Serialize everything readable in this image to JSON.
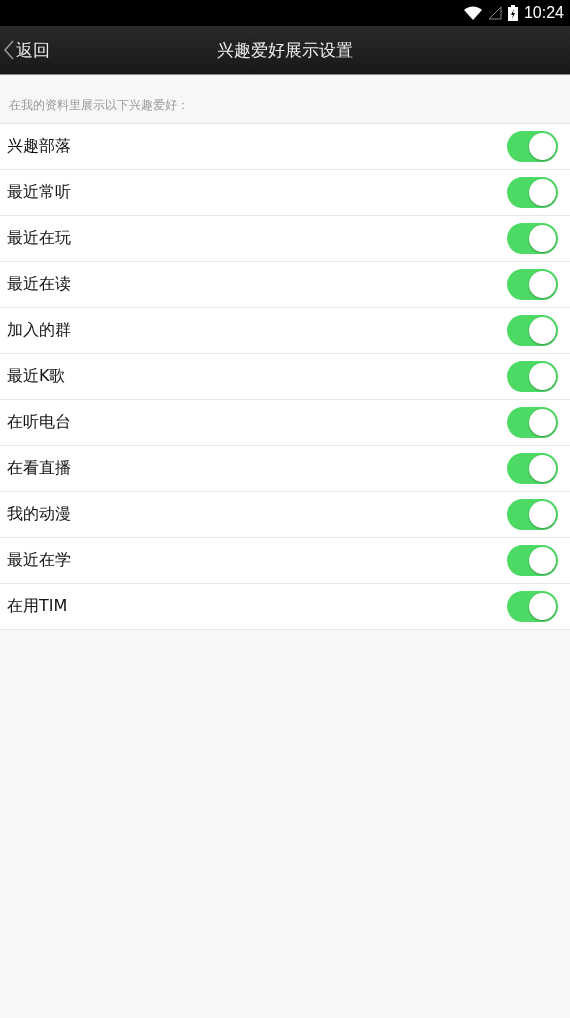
{
  "status_bar": {
    "time": "10:24"
  },
  "nav": {
    "back": "返回",
    "title": "兴趣爱好展示设置"
  },
  "section_hint": "在我的资料里展示以下兴趣爱好：",
  "settings": [
    {
      "label": "兴趣部落",
      "on": true
    },
    {
      "label": "最近常听",
      "on": true
    },
    {
      "label": "最近在玩",
      "on": true
    },
    {
      "label": "最近在读",
      "on": true
    },
    {
      "label": "加入的群",
      "on": true
    },
    {
      "label": "最近K歌",
      "on": true
    },
    {
      "label": "在听电台",
      "on": true
    },
    {
      "label": "在看直播",
      "on": true
    },
    {
      "label": "我的动漫",
      "on": true
    },
    {
      "label": "最近在学",
      "on": true
    },
    {
      "label": "在用TIM",
      "on": true
    }
  ]
}
